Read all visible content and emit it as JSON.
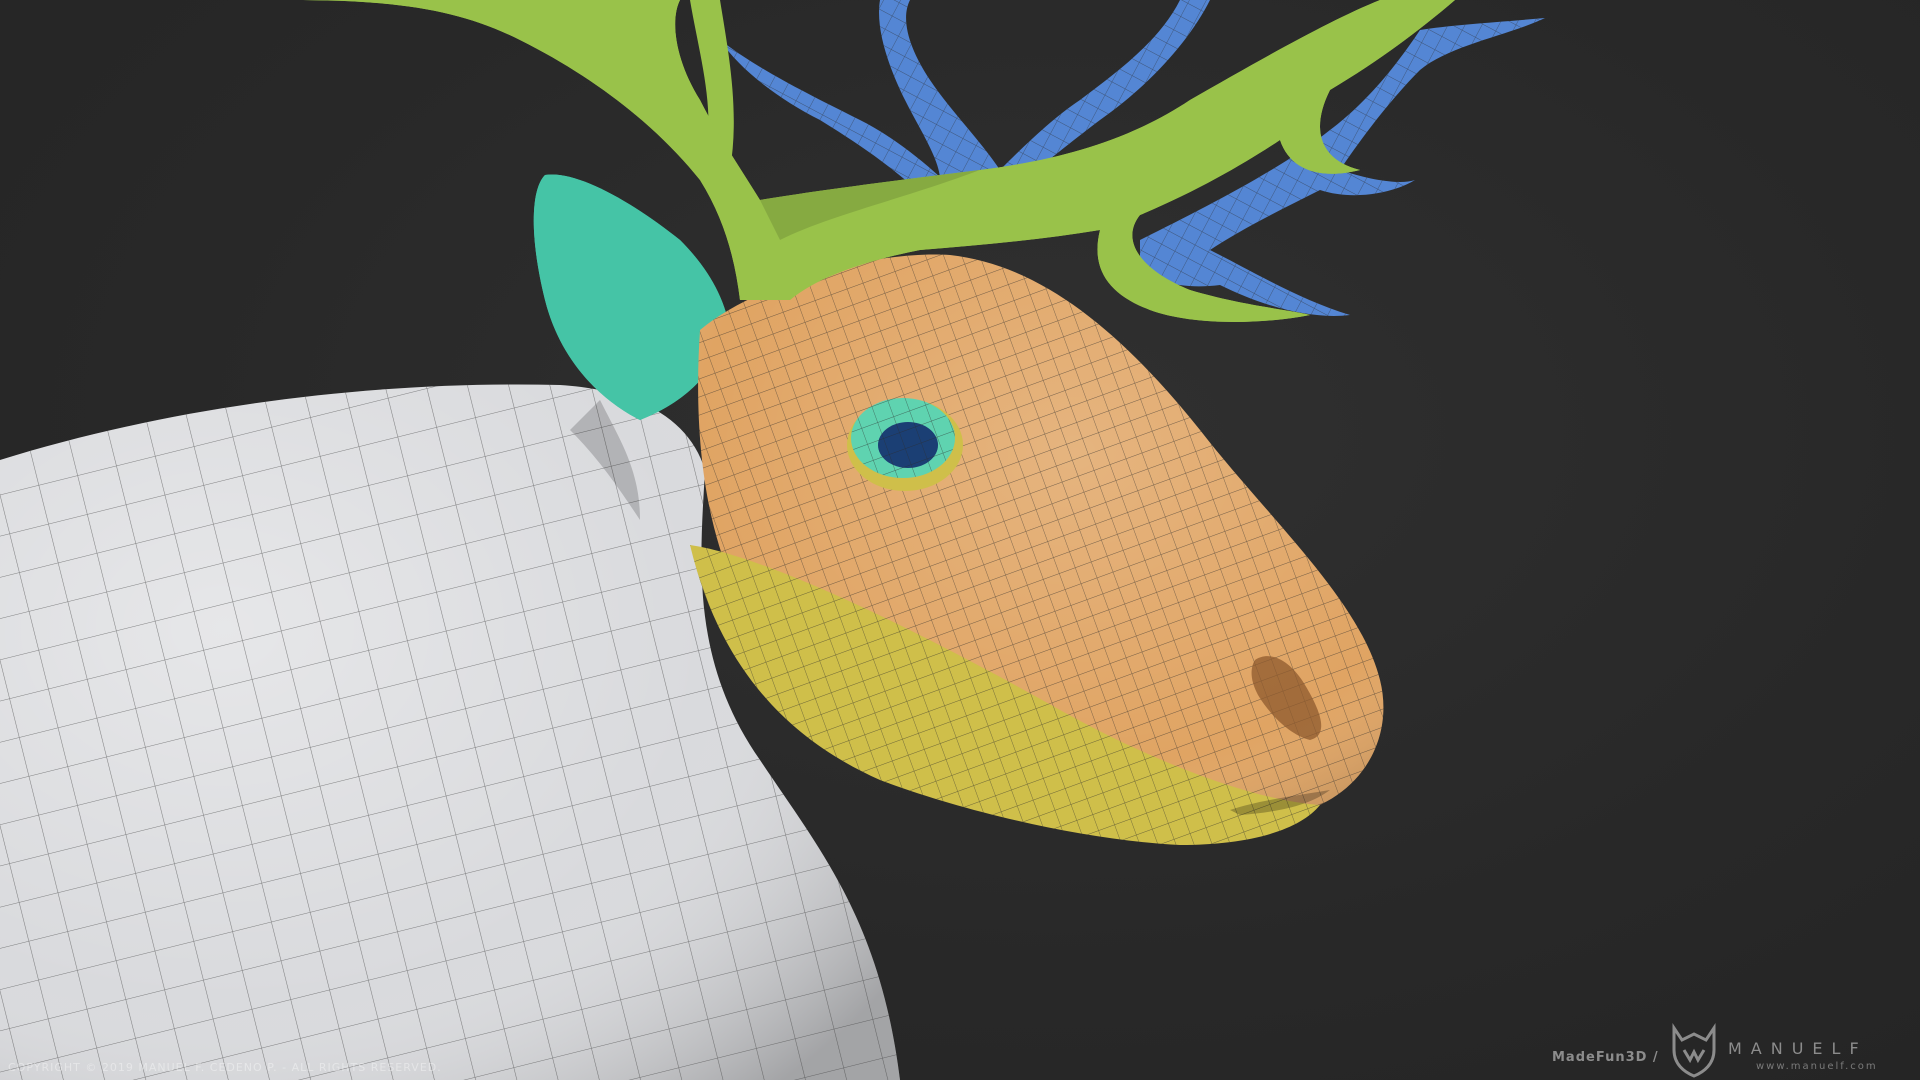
{
  "overlay": {
    "copyright": "COPYRIGHT © 2019 MANUEL F. CEDENO P. - ALL RIGHTS RESERVED.",
    "brand_label": "MadeFun3D /",
    "brand_name": "MANUELF",
    "brand_url": "www.manuelf.com"
  },
  "colors": {
    "background": "#2a2a2a",
    "neck": "#d9dadd",
    "head": "#e0a463",
    "jaw": "#cfbf4a",
    "ear": "#45c4a6",
    "eye": "#1b3f74",
    "eye_ring": "#5fd3b0",
    "antler_front": "#99c24a",
    "antler_back": "#5486d4",
    "wireframe": "#2e2e2e"
  },
  "icons": [
    "manuelf-logo-icon"
  ]
}
